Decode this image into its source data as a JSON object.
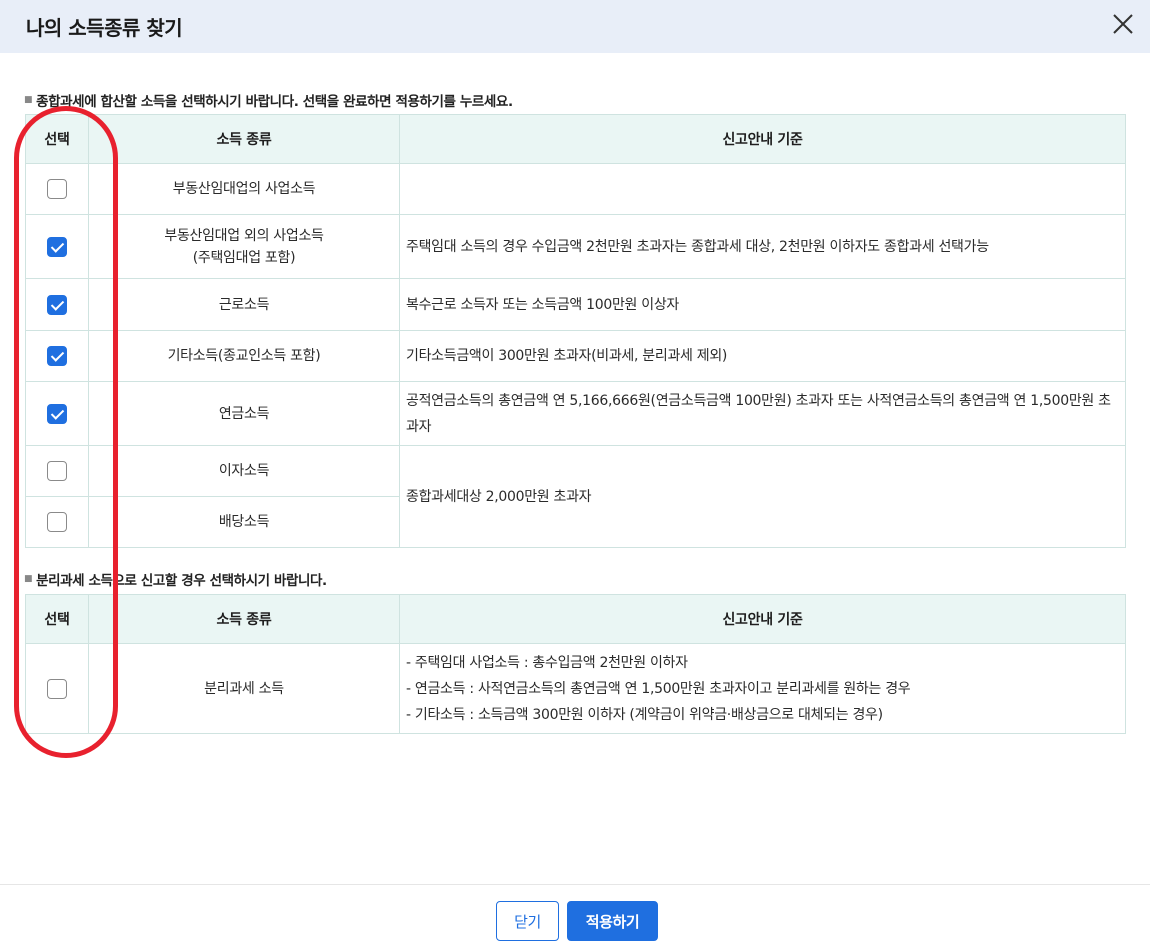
{
  "dialog": {
    "title": "나의 소득종류 찾기",
    "close_icon": "close-icon"
  },
  "section1": {
    "note": "종합과세에 합산할 소득을 선택하시기 바랍니다. 선택을 완료하면 적용하기를 누르세요.",
    "headers": {
      "select": "선택",
      "kind": "소득 종류",
      "guide": "신고안내 기준"
    },
    "rows": [
      {
        "checked": false,
        "kind": "부동산임대업의 사업소득",
        "kind_sub": "",
        "guide": ""
      },
      {
        "checked": true,
        "kind": "부동산임대업 외의 사업소득",
        "kind_sub": "(주택임대업 포함)",
        "guide": "주택임대 소득의 경우 수입금액 2천만원 초과자는 종합과세 대상, 2천만원 이하자도 종합과세 선택가능"
      },
      {
        "checked": true,
        "kind": "근로소득",
        "kind_sub": "",
        "guide": "복수근로 소득자 또는 소득금액 100만원 이상자"
      },
      {
        "checked": true,
        "kind": "기타소득(종교인소득 포함)",
        "kind_sub": "",
        "guide": "기타소득금액이 300만원 초과자(비과세, 분리과세 제외)"
      },
      {
        "checked": true,
        "kind": "연금소득",
        "kind_sub": "",
        "guide": "공적연금소득의 총연금액 연 5,166,666원(연금소득금액 100만원) 초과자 또는 사적연금소득의 총연금액 연 1,500만원 초과자"
      },
      {
        "checked": false,
        "kind": "이자소득",
        "kind_sub": "",
        "guide": "종합과세대상 2,000만원 초과자"
      },
      {
        "checked": false,
        "kind": "배당소득",
        "kind_sub": "",
        "guide": ""
      }
    ]
  },
  "section2": {
    "note": "분리과세 소득으로 신고할 경우 선택하시기 바랍니다.",
    "headers": {
      "select": "선택",
      "kind": "소득 종류",
      "guide": "신고안내 기준"
    },
    "row": {
      "checked": false,
      "kind": "분리과세 소득",
      "guide_lines": [
        "- 주택임대 사업소득 : 총수입금액 2천만원 이하자",
        "- 연금소득 : 사적연금소득의 총연금액 연 1,500만원 초과자이고 분리과세를 원하는 경우",
        "- 기타소득 : 소득금액 300만원 이하자 (계약금이 위약금·배상금으로 대체되는 경우)"
      ]
    }
  },
  "footer": {
    "close_label": "닫기",
    "apply_label": "적용하기"
  },
  "colors": {
    "accent": "#1f6fe0",
    "highlight": "#e8212e",
    "header_bg": "#e8eef8",
    "table_header_bg": "#eaf6f4"
  }
}
